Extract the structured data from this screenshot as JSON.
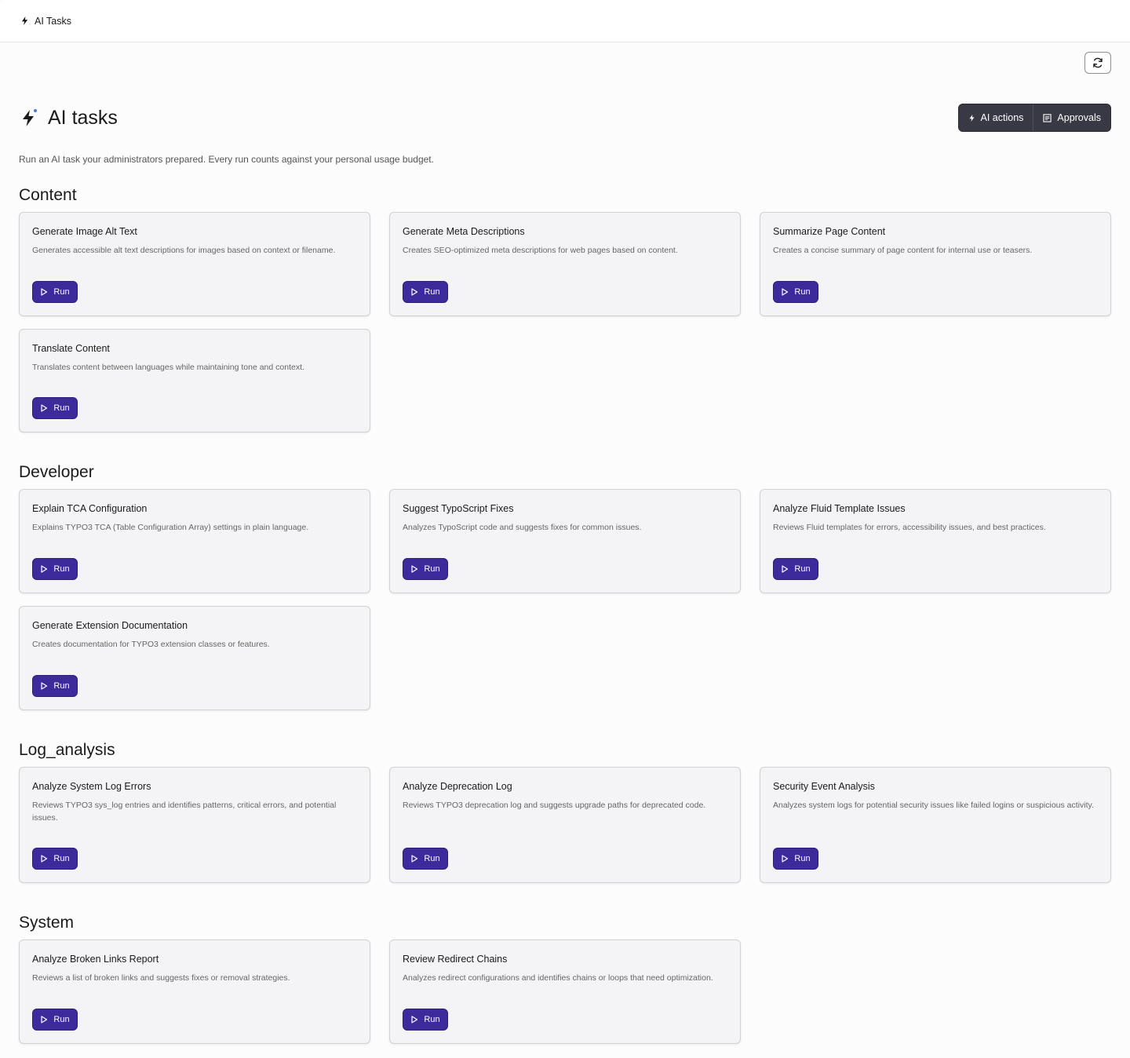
{
  "topbar": {
    "title": "AI Tasks"
  },
  "page": {
    "title": "AI tasks",
    "subtitle": "Run an AI task your administrators prepared. Every run counts against your personal usage budget."
  },
  "actions": {
    "ai_actions_label": "AI actions",
    "approvals_label": "Approvals"
  },
  "run_label": "Run",
  "colors": {
    "accent": "#3d2a9b",
    "button_group_bg": "#383944"
  },
  "sections": [
    {
      "name": "Content",
      "cards": [
        {
          "title": "Generate Image Alt Text",
          "description": "Generates accessible alt text descriptions for images based on context or filename."
        },
        {
          "title": "Generate Meta Descriptions",
          "description": "Creates SEO-optimized meta descriptions for web pages based on content."
        },
        {
          "title": "Summarize Page Content",
          "description": "Creates a concise summary of page content for internal use or teasers."
        },
        {
          "title": "Translate Content",
          "description": "Translates content between languages while maintaining tone and context."
        }
      ]
    },
    {
      "name": "Developer",
      "cards": [
        {
          "title": "Explain TCA Configuration",
          "description": "Explains TYPO3 TCA (Table Configuration Array) settings in plain language."
        },
        {
          "title": "Suggest TypoScript Fixes",
          "description": "Analyzes TypoScript code and suggests fixes for common issues."
        },
        {
          "title": "Analyze Fluid Template Issues",
          "description": "Reviews Fluid templates for errors, accessibility issues, and best practices."
        },
        {
          "title": "Generate Extension Documentation",
          "description": "Creates documentation for TYPO3 extension classes or features."
        }
      ]
    },
    {
      "name": "Log_analysis",
      "cards": [
        {
          "title": "Analyze System Log Errors",
          "description": "Reviews TYPO3 sys_log entries and identifies patterns, critical errors, and potential issues."
        },
        {
          "title": "Analyze Deprecation Log",
          "description": "Reviews TYPO3 deprecation log and suggests upgrade paths for deprecated code."
        },
        {
          "title": "Security Event Analysis",
          "description": "Analyzes system logs for potential security issues like failed logins or suspicious activity."
        }
      ]
    },
    {
      "name": "System",
      "cards": [
        {
          "title": "Analyze Broken Links Report",
          "description": "Reviews a list of broken links and suggests fixes or removal strategies."
        },
        {
          "title": "Review Redirect Chains",
          "description": "Analyzes redirect configurations and identifies chains or loops that need optimization."
        }
      ]
    }
  ]
}
